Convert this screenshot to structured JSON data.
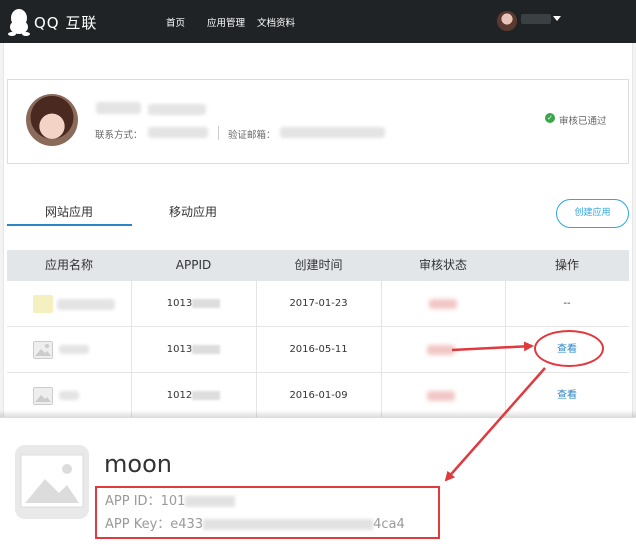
{
  "nav": {
    "logo_text": "QQ 互联",
    "links": [
      "首页",
      "应用管理",
      "文档资料"
    ]
  },
  "profile": {
    "contact_label": "联系方式：",
    "email_label": "验证邮箱：",
    "status": "审核已通过"
  },
  "tabs": [
    "网站应用",
    "移动应用"
  ],
  "create_button": "创建应用",
  "table": {
    "headers": [
      "应用名称",
      "APPID",
      "创建时间",
      "审核状态",
      "操作"
    ],
    "rows": [
      {
        "appid": "1013",
        "created": "2017-01-23",
        "action": "--"
      },
      {
        "appid": "1013",
        "created": "2016-05-11",
        "action": "查看"
      },
      {
        "appid": "1012",
        "created": "2016-01-09",
        "action": "查看"
      }
    ]
  },
  "detail": {
    "app_name": "moon",
    "app_id_label": "APP ID：",
    "app_id_value": "101",
    "app_key_label": "APP Key：",
    "app_key_prefix": "e433",
    "app_key_suffix": "4ca4"
  },
  "colors": {
    "nav_bg": "#1f2325",
    "accent": "#2a86c8",
    "highlight": "#e0393e",
    "verified": "#3aa84a"
  }
}
